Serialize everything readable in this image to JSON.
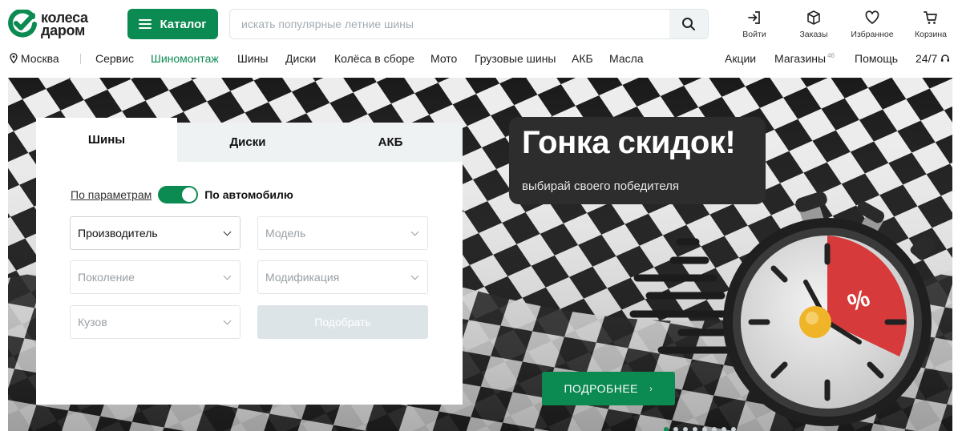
{
  "brand": {
    "name_line1": "колеса",
    "name_line2": "даром",
    "accent": "#0b8a52"
  },
  "header": {
    "catalog_label": "Каталог",
    "search_placeholder": "искать популярные летние шины",
    "actions": [
      {
        "label": "Войти",
        "icon": "login-icon"
      },
      {
        "label": "Заказы",
        "icon": "box-icon"
      },
      {
        "label": "Избранное",
        "icon": "heart-icon"
      },
      {
        "label": "Корзина",
        "icon": "cart-icon"
      }
    ]
  },
  "nav": {
    "city": "Москва",
    "items": [
      "Сервис",
      "Шиномонтаж",
      "Шины",
      "Диски",
      "Колёса в сборе",
      "Мото",
      "Грузовые шины",
      "АКБ",
      "Масла"
    ],
    "active_item": "Шиномонтаж",
    "right": {
      "promo": "Акции",
      "stores": "Магазины",
      "stores_count": "46",
      "help": "Помощь",
      "support": "24/7"
    }
  },
  "banner": {
    "title": "Гонка скидок!",
    "subtitle": "выбирай своего победителя",
    "button_label": "ПОДРОБНЕЕ",
    "badge_symbol": "%"
  },
  "selector": {
    "tabs": [
      {
        "label": "Шины",
        "active": true
      },
      {
        "label": "Диски",
        "active": false
      },
      {
        "label": "АКБ",
        "active": false
      }
    ],
    "mode_params": "По параметрам",
    "mode_car": "По автомобилю",
    "toggle_on": true,
    "fields": {
      "manufacturer": "Производитель",
      "model": "Модель",
      "generation": "Поколение",
      "modification": "Модификация",
      "body": "Кузов"
    },
    "submit_label": "Подобрать"
  }
}
